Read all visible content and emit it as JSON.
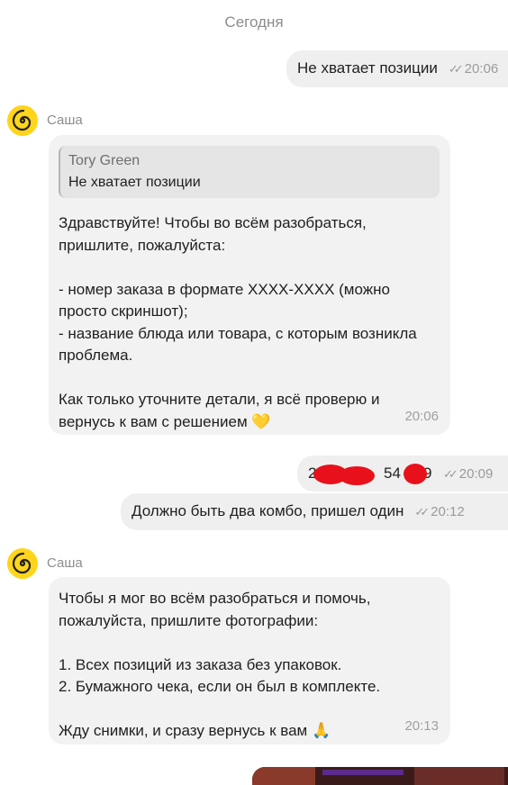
{
  "date_separator": "Сегодня",
  "messages": {
    "out1": {
      "text": "Не хватает позиции",
      "time": "20:06",
      "status_icon": "double-check-icon"
    },
    "in1": {
      "sender": "Саша",
      "avatar_icon": "spiral-logo-icon",
      "reply_to": {
        "author": "Tory Green",
        "text": "Не хватает позиции"
      },
      "text": "Здравствуйте! Чтобы во всём разобраться, пришлите, пожалуйста:\n\n- номер заказа в формате XXXX-XXXX (можно просто скриншот);\n- название блюда или товара, с которым возникла проблема.\n\nКак только уточните детали, я всё проверю и вернусь к вам с решением 💛",
      "time": "20:06"
    },
    "out2": {
      "text_parts": [
        "2",
        "54",
        "9"
      ],
      "redacted": true,
      "time": "20:09",
      "status_icon": "double-check-icon"
    },
    "out3": {
      "text": "Должно быть два комбо, пришел один",
      "time": "20:12",
      "status_icon": "double-check-icon"
    },
    "in2": {
      "sender": "Саша",
      "avatar_icon": "spiral-logo-icon",
      "text": "Чтобы я мог во всём разобраться и помочь, пожалуйста, пришлите фотографии:\n\n1. Всех позиций из заказа без упаковок.\n2. Бумажного чека, если он был в комплекте.\n\nЖду снимки, и сразу вернусь к вам 🙏",
      "time": "20:13"
    },
    "out4": {
      "type": "photo",
      "note": ""
    }
  },
  "colors": {
    "outgoing_bubble": "#efefef",
    "incoming_bubble": "#f2f2f2",
    "avatar_bg": "#ffd51c",
    "redaction": "#e8111b"
  }
}
